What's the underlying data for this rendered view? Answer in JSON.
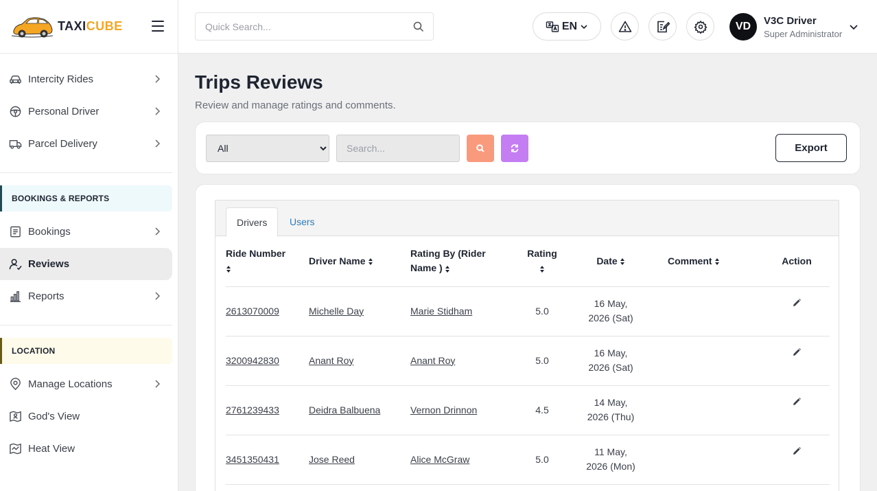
{
  "brand": {
    "part1": "TAXI",
    "part2": "CUBE"
  },
  "sidebar": {
    "items_top": [
      {
        "label": "Intercity Rides"
      },
      {
        "label": "Personal Driver"
      },
      {
        "label": "Parcel Delivery"
      }
    ],
    "section_bookings": "BOOKINGS & REPORTS",
    "items_bookings": [
      {
        "label": "Bookings"
      },
      {
        "label": "Reviews"
      },
      {
        "label": "Reports"
      }
    ],
    "section_location": "LOCATION",
    "items_location": [
      {
        "label": "Manage Locations"
      },
      {
        "label": "God's View"
      },
      {
        "label": "Heat View"
      }
    ]
  },
  "topbar": {
    "search_placeholder": "Quick Search...",
    "language": "EN",
    "user": {
      "initials": "VD",
      "name": "V3C Driver",
      "role": "Super Administrator"
    }
  },
  "page": {
    "title": "Trips Reviews",
    "subtitle": "Review and manage ratings and comments."
  },
  "filters": {
    "select_value": "All",
    "search_placeholder": "Search...",
    "export_label": "Export"
  },
  "tabs": [
    {
      "label": "Drivers"
    },
    {
      "label": "Users"
    }
  ],
  "table": {
    "headers": {
      "ride_number": "Ride Number",
      "driver_name": "Driver Name",
      "rating_by_1": "Rating By (Rider",
      "rating_by_2": "Name )",
      "rating": "Rating",
      "date": "Date",
      "comment": "Comment",
      "action": "Action"
    },
    "rows": [
      {
        "ride": "2613070009",
        "driver": "Michelle Day",
        "rider": "Marie Stidham",
        "rating": "5.0",
        "date1": "16 May,",
        "date2": "2026 (Sat)",
        "comment": ""
      },
      {
        "ride": "3200942830",
        "driver": "Anant Roy",
        "rider": "Anant Roy",
        "rating": "5.0",
        "date1": "16 May,",
        "date2": "2026 (Sat)",
        "comment": ""
      },
      {
        "ride": "2761239433",
        "driver": "Deidra Balbuena",
        "rider": "Vernon Drinnon",
        "rating": "4.5",
        "date1": "14 May,",
        "date2": "2026 (Thu)",
        "comment": ""
      },
      {
        "ride": "3451350431",
        "driver": "Jose Reed",
        "rider": "Alice McGraw",
        "rating": "5.0",
        "date1": "11 May,",
        "date2": "2026 (Mon)",
        "comment": ""
      }
    ]
  }
}
